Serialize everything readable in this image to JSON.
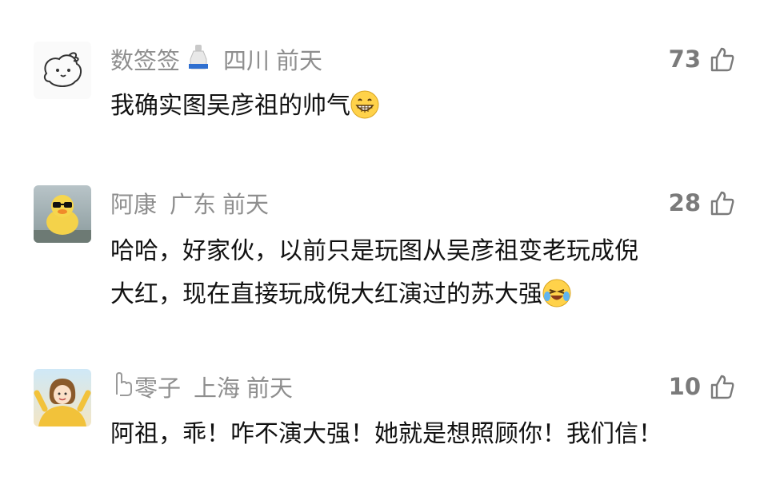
{
  "comments": [
    {
      "user": "数签签",
      "location": "四川",
      "time": "前天",
      "likes": "73",
      "text": "我确实图吴彦祖的帅气",
      "badge_icon": "bottle-icon",
      "emoji": "grin-emoji"
    },
    {
      "user": "阿康",
      "location": "广东",
      "time": "前天",
      "likes": "28",
      "text_line1": "哈哈，好家伙，以前只是玩图从吴彦祖变老玩成倪",
      "text_line2": "大红，现在直接玩成倪大红演过的苏大强",
      "emoji": "laugh-cry-emoji"
    },
    {
      "user": "零子",
      "location": "上海",
      "time": "前天",
      "likes": "10",
      "text": "阿祖，乖！咋不演大强！她就是想照顾你！我们信！",
      "prefix_icon": "outline-finger-icon"
    }
  ],
  "colors": {
    "meta": "#8e8e8e",
    "text": "#111111",
    "background": "#ffffff"
  }
}
